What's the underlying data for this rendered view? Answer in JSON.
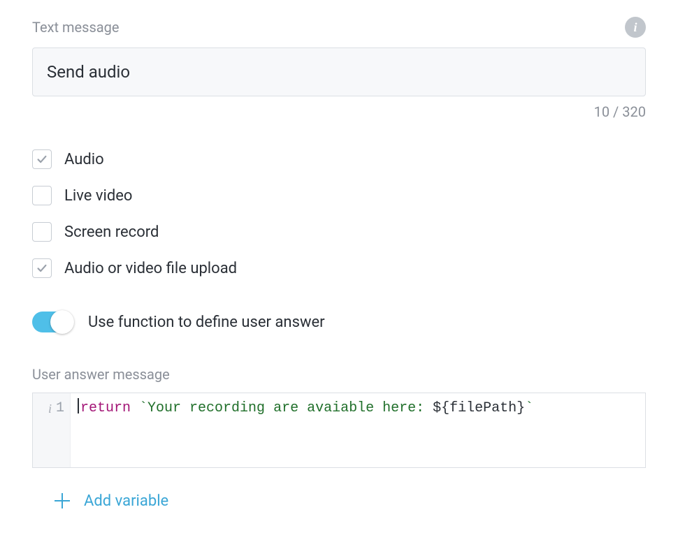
{
  "textMessage": {
    "label": "Text message",
    "value": "Send audio",
    "count": "10",
    "limit": "320"
  },
  "options": [
    {
      "key": "audio",
      "label": "Audio",
      "checked": true
    },
    {
      "key": "live-video",
      "label": "Live video",
      "checked": false
    },
    {
      "key": "screen-record",
      "label": "Screen record",
      "checked": false
    },
    {
      "key": "file-upload",
      "label": "Audio or video file upload",
      "checked": true
    }
  ],
  "toggle": {
    "label": "Use function to define user answer",
    "on": true
  },
  "userAnswer": {
    "label": "User answer message",
    "lineNumber": "1",
    "code": {
      "kw": "return",
      "strPrefix": "`Your recording are avaiable here: ",
      "tpl": "${filePath}",
      "strSuffix": "`"
    }
  },
  "addVariable": {
    "label": "Add variable"
  }
}
